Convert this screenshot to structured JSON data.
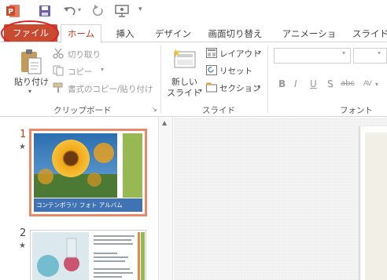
{
  "qat": {
    "icons": [
      "powerpoint-logo-icon",
      "save-icon",
      "undo-icon",
      "redo-icon",
      "slideshow-from-start-icon",
      "customize-qat-icon"
    ]
  },
  "tabs": {
    "file": "ファイル",
    "home": "ホーム",
    "insert": "挿入",
    "design": "デザイン",
    "transitions": "画面切り替え",
    "animations": "アニメーション",
    "slideshow": "スライド シ"
  },
  "clipboard": {
    "paste": "貼り付け",
    "cut": "切り取り",
    "copy": "コピー",
    "format_painter": "書式のコピー/貼り付け",
    "group_label": "クリップボード"
  },
  "slides": {
    "new_slide_line1": "新しい",
    "new_slide_line2": "スライド",
    "layout": "レイアウト",
    "reset": "リセット",
    "section": "セクション",
    "group_label": "スライド"
  },
  "font": {
    "bold": "B",
    "italic": "I",
    "underline": "U",
    "shadow": "S",
    "strike": "abc",
    "spacing": "AV",
    "group_label": "フォント"
  },
  "thumbnails": [
    {
      "number": "1",
      "title": "コンテンポラリ フォト アルバム",
      "selected": true
    },
    {
      "number": "2",
      "title": "",
      "selected": false
    }
  ],
  "colors": {
    "file_tab": "#c84b31",
    "accent": "#c43e1c",
    "selection": "#e58a6b",
    "highlight_ring": "#e02020"
  }
}
